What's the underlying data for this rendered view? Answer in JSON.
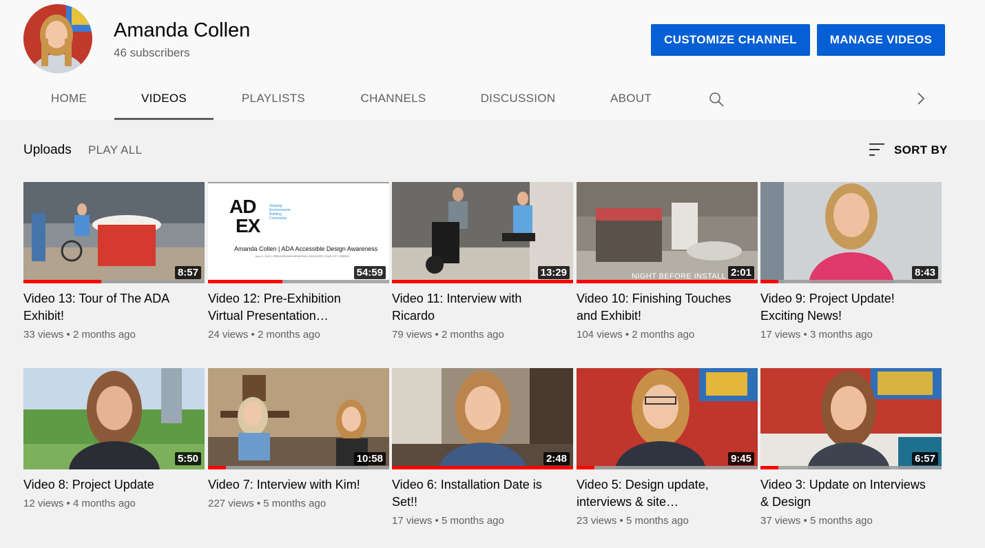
{
  "channel": {
    "name": "Amanda Collen",
    "subscribers": "46 subscribers",
    "customize_label": "CUSTOMIZE CHANNEL",
    "manage_label": "MANAGE VIDEOS"
  },
  "tabs": [
    {
      "label": "HOME"
    },
    {
      "label": "VIDEOS",
      "active": true
    },
    {
      "label": "PLAYLISTS"
    },
    {
      "label": "CHANNELS"
    },
    {
      "label": "DISCUSSION"
    },
    {
      "label": "ABOUT"
    }
  ],
  "section": {
    "uploads_label": "Uploads",
    "play_all_label": "PLAY ALL",
    "sort_label": "SORT BY"
  },
  "colors": {
    "accent": "#065fd4",
    "progress": "#ff0000"
  },
  "videos": [
    {
      "title": "Video 13: Tour of The ADA Exhibit!",
      "meta": "33 views • 2 months ago",
      "duration": "8:57",
      "watched": 0.43
    },
    {
      "title": "Video 12: Pre-Exhibition Virtual Presentation…",
      "meta": "24 views • 2 months ago",
      "duration": "54:59",
      "watched": 0.41,
      "thumb_logo_top": "AD",
      "thumb_logo_bottom": "EX",
      "thumb_tagline": "Shaping Environments, Building Community",
      "thumb_caption": "Amanda Collen | ADA Accessible Design Awareness",
      "thumb_subcaption": "June 3, 2021  |  ERIKA BROWN MEMORIAL DISCOVER YOUR CITY SERIES"
    },
    {
      "title": "Video 11: Interview with Ricardo",
      "meta": "79 views • 2 months ago",
      "duration": "13:29",
      "watched": 1.0
    },
    {
      "title": "Video 10: Finishing Touches and Exhibit!",
      "meta": "104 views • 2 months ago",
      "duration": "2:01",
      "watched": 1.0,
      "thumb_overlay": "NIGHT BEFORE INSTALL"
    },
    {
      "title": "Video 9: Project Update! Exciting News!",
      "meta": "17 views • 3 months ago",
      "duration": "8:43",
      "watched": 0.1
    },
    {
      "title": "Video 8: Project Update",
      "meta": "12 views • 4 months ago",
      "duration": "5:50",
      "watched": 0.0
    },
    {
      "title": "Video 7: Interview with Kim!",
      "meta": "227 views • 5 months ago",
      "duration": "10:58",
      "watched": 0.1
    },
    {
      "title": "Video 6: Installation Date is Set!!",
      "meta": "17 views • 5 months ago",
      "duration": "2:48",
      "watched": 1.0
    },
    {
      "title": "Video 5: Design update, interviews & site…",
      "meta": "23 views • 5 months ago",
      "duration": "9:45",
      "watched": 0.1
    },
    {
      "title": "Video 3: Update on Interviews & Design",
      "meta": "37 views • 5 months ago",
      "duration": "6:57",
      "watched": 0.1
    }
  ]
}
